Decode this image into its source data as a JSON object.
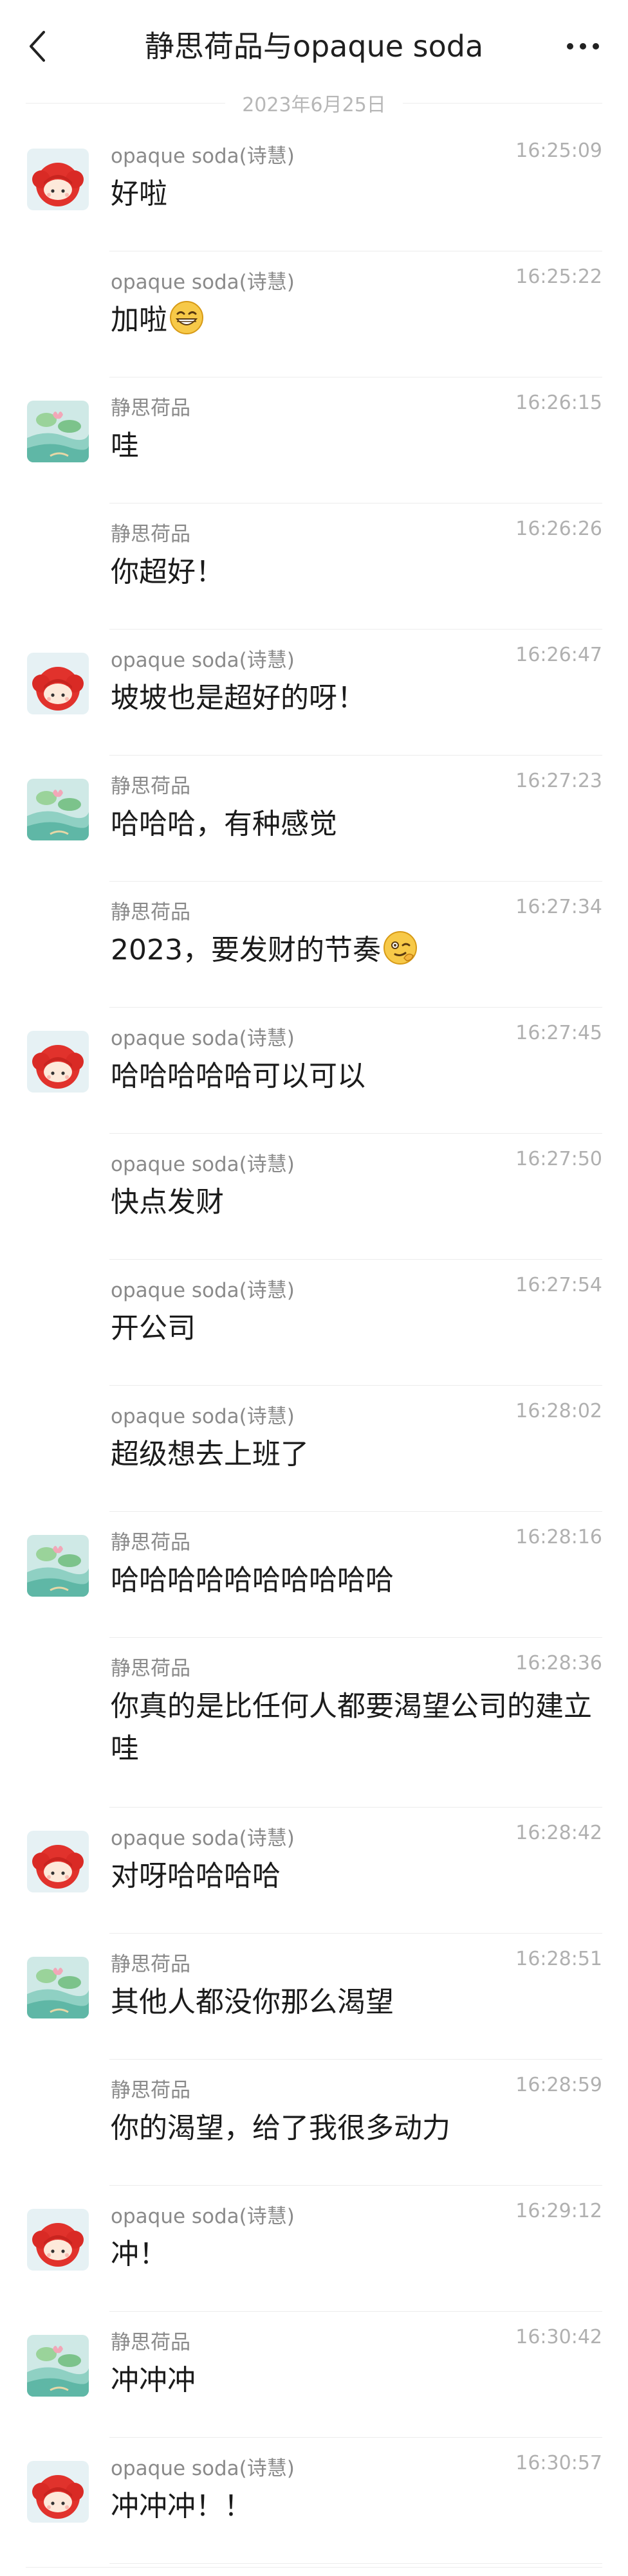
{
  "header": {
    "title": "静思荷品与opaque soda"
  },
  "date_separator": "2023年6月25日",
  "messages": [
    {
      "sender": "opaque soda(诗慧)",
      "time": "16:25:09",
      "text": "好啦",
      "avatar": "red-hair-avatar",
      "emoji": ""
    },
    {
      "sender": "opaque soda(诗慧)",
      "time": "16:25:22",
      "text": "加啦",
      "avatar": "",
      "emoji": "grin-emoji"
    },
    {
      "sender": "静思荷品",
      "time": "16:26:15",
      "text": "哇",
      "avatar": "lotus-avatar",
      "emoji": ""
    },
    {
      "sender": "静思荷品",
      "time": "16:26:26",
      "text": "你超好！",
      "avatar": "",
      "emoji": ""
    },
    {
      "sender": "opaque soda(诗慧)",
      "time": "16:26:47",
      "text": "坡坡也是超好的呀！",
      "avatar": "red-hair-avatar",
      "emoji": ""
    },
    {
      "sender": "静思荷品",
      "time": "16:27:23",
      "text": "哈哈哈，有种感觉",
      "avatar": "lotus-avatar",
      "emoji": ""
    },
    {
      "sender": "静思荷品",
      "time": "16:27:34",
      "text": "2023，要发财的节奏",
      "avatar": "",
      "emoji": "wink-emoji"
    },
    {
      "sender": "opaque soda(诗慧)",
      "time": "16:27:45",
      "text": "哈哈哈哈哈可以可以",
      "avatar": "red-hair-avatar",
      "emoji": ""
    },
    {
      "sender": "opaque soda(诗慧)",
      "time": "16:27:50",
      "text": "快点发财",
      "avatar": "",
      "emoji": ""
    },
    {
      "sender": "opaque soda(诗慧)",
      "time": "16:27:54",
      "text": "开公司",
      "avatar": "",
      "emoji": ""
    },
    {
      "sender": "opaque soda(诗慧)",
      "time": "16:28:02",
      "text": "超级想去上班了",
      "avatar": "",
      "emoji": ""
    },
    {
      "sender": "静思荷品",
      "time": "16:28:16",
      "text": "哈哈哈哈哈哈哈哈哈哈",
      "avatar": "lotus-avatar",
      "emoji": ""
    },
    {
      "sender": "静思荷品",
      "time": "16:28:36",
      "text": "你真的是比任何人都要渴望公司的建立哇",
      "avatar": "",
      "emoji": ""
    },
    {
      "sender": "opaque soda(诗慧)",
      "time": "16:28:42",
      "text": "对呀哈哈哈哈",
      "avatar": "red-hair-avatar",
      "emoji": ""
    },
    {
      "sender": "静思荷品",
      "time": "16:28:51",
      "text": "其他人都没你那么渴望",
      "avatar": "lotus-avatar",
      "emoji": ""
    },
    {
      "sender": "静思荷品",
      "time": "16:28:59",
      "text": "你的渴望，给了我很多动力",
      "avatar": "",
      "emoji": ""
    },
    {
      "sender": "opaque soda(诗慧)",
      "time": "16:29:12",
      "text": "冲！",
      "avatar": "red-hair-avatar",
      "emoji": ""
    },
    {
      "sender": "静思荷品",
      "time": "16:30:42",
      "text": "冲冲冲",
      "avatar": "lotus-avatar",
      "emoji": ""
    },
    {
      "sender": "opaque soda(诗慧)",
      "time": "16:30:57",
      "text": "冲冲冲！！",
      "avatar": "red-hair-avatar",
      "emoji": ""
    }
  ]
}
